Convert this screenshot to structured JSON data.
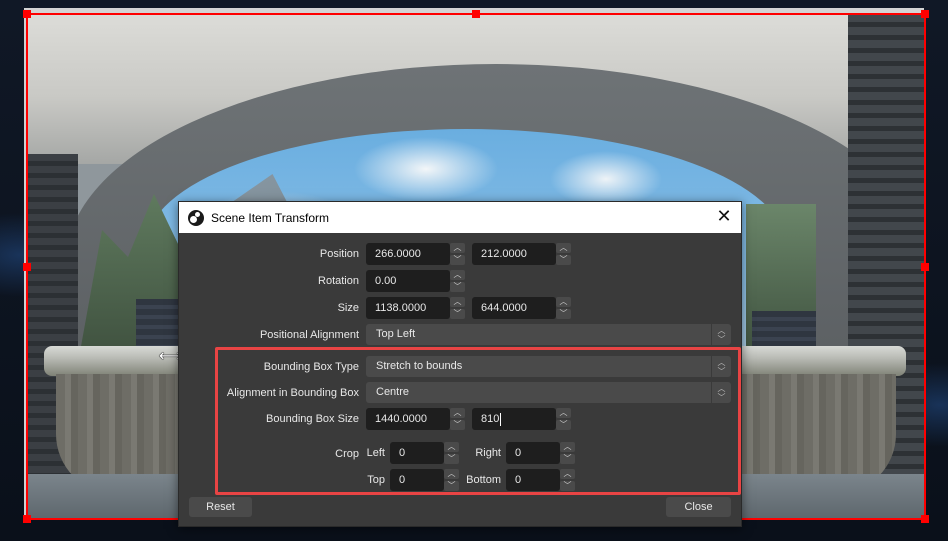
{
  "dialog": {
    "title": "Scene Item Transform",
    "close_icon": "close-icon",
    "app_icon": "obs-logo-icon",
    "position": {
      "label": "Position",
      "x": "266.0000",
      "y": "212.0000"
    },
    "rotation": {
      "label": "Rotation",
      "value": "0.00"
    },
    "size": {
      "label": "Size",
      "width": "1138.0000",
      "height": "644.0000"
    },
    "positional_alignment": {
      "label": "Positional Alignment",
      "value": "Top Left"
    },
    "bounding_box_type": {
      "label": "Bounding Box Type",
      "value": "Stretch to bounds"
    },
    "alignment_in_bounding_box": {
      "label": "Alignment in Bounding Box",
      "value": "Centre"
    },
    "bounding_box_size": {
      "label": "Bounding Box Size",
      "width": "1440.0000",
      "height": "810"
    },
    "crop": {
      "label": "Crop",
      "left_label": "Left",
      "left": "0",
      "right_label": "Right",
      "right": "0",
      "top_label": "Top",
      "top": "0",
      "bottom_label": "Bottom",
      "bottom": "0"
    },
    "reset_label": "Reset",
    "close_label": "Close",
    "spin_up_glyph": "︿",
    "spin_down_glyph": "﹀",
    "combo_glyph_up": "︿",
    "combo_glyph_down": "﹀",
    "close_glyph": "✕"
  },
  "cursor": {
    "icon": "resize-horizontal-cursor-icon",
    "glyph": "⟷"
  },
  "colors": {
    "selection": "#ff0000",
    "highlight_box": "#e84444",
    "dialog_bg": "#3a3a3a",
    "input_bg": "#1e1e1e",
    "combo_bg": "#4a4a4a"
  }
}
